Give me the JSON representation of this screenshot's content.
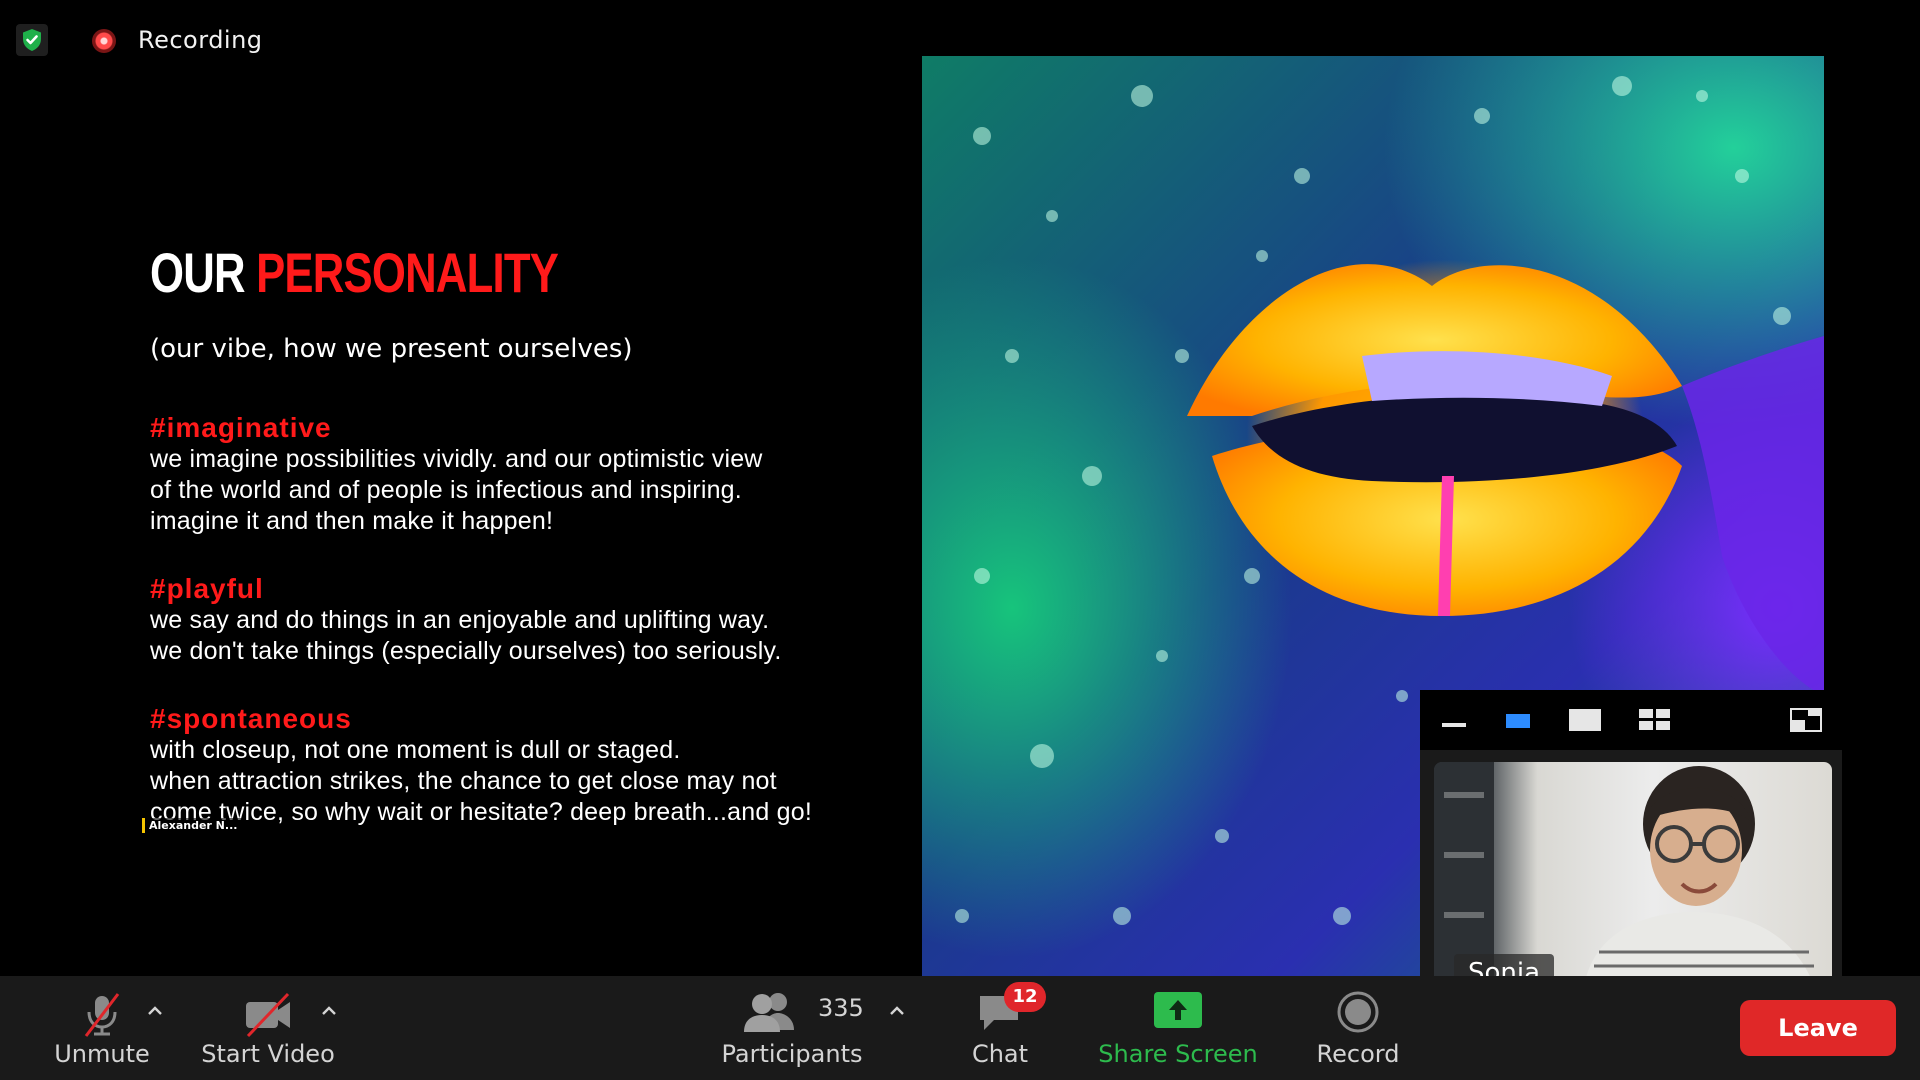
{
  "status": {
    "recording_label": "Recording"
  },
  "slide": {
    "title_part1": "OUR ",
    "title_part2": "PERSONALITY",
    "subtitle": "(our vibe, how we present  ourselves)",
    "traits": [
      {
        "tag": "#imaginative",
        "lines": [
          "we imagine possibilities vividly. and our optimistic view",
          "of the world and of people is infectious and inspiring.",
          "imagine it and then make it happen!"
        ]
      },
      {
        "tag": "#playful",
        "lines": [
          "we say and do things in an enjoyable and uplifting way.",
          "we don't take things (especially ourselves) too seriously."
        ]
      },
      {
        "tag": "#spontaneous",
        "lines": [
          "with closeup, not one moment is dull or staged.",
          "when attraction strikes, the chance to get close may not",
          "come twice, so why wait or hesitate? deep breath...and go!"
        ]
      }
    ],
    "presenter_label": "Alexander N..."
  },
  "thumbnail": {
    "participant_name": "Sonia"
  },
  "toolbar": {
    "unmute_label": "Unmute",
    "start_video_label": "Start Video",
    "participants_label": "Participants",
    "participants_count": "335",
    "chat_label": "Chat",
    "chat_badge": "12",
    "share_label": "Share Screen",
    "record_label": "Record",
    "leave_label": "Leave"
  },
  "colors": {
    "accent_red": "#ff1a1a",
    "share_green": "#2dbb4d",
    "leave_red": "#e02828",
    "shield_green": "#1fb04a",
    "view_active_blue": "#2d8cff"
  },
  "icons": [
    "shield-check-icon",
    "recording-dot-icon",
    "mic-muted-icon",
    "video-off-icon",
    "participants-icon",
    "chat-icon",
    "share-screen-icon",
    "record-icon",
    "chevron-up-icon",
    "view-minimize-icon",
    "view-speaker-icon",
    "view-single-icon",
    "view-gallery-icon",
    "view-exit-icon"
  ]
}
